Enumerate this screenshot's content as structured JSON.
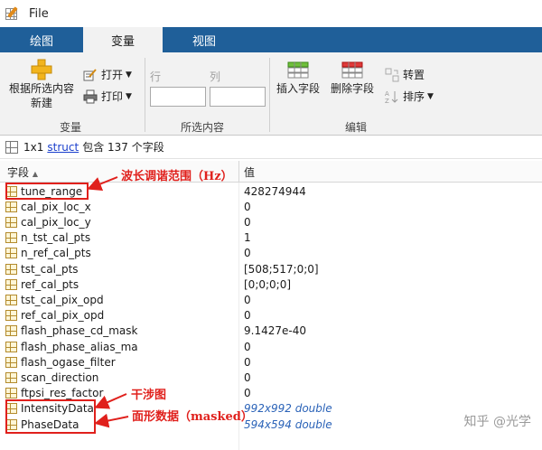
{
  "window": {
    "title": "File"
  },
  "tabs": [
    {
      "label": "绘图"
    },
    {
      "label": "变量"
    },
    {
      "label": "视图"
    }
  ],
  "ribbon": {
    "variable": {
      "new_from_selection_line1": "根据所选内容",
      "new_from_selection_line2": "新建",
      "open": "打开",
      "print": "打印",
      "group_label": "变量"
    },
    "selection": {
      "row_label": "行",
      "col_label": "列",
      "group_label": "所选内容"
    },
    "edit": {
      "insert_field": "插入字段",
      "delete_field": "删除字段",
      "transpose": "转置",
      "sort": "排序",
      "group_label": "编辑"
    }
  },
  "info": {
    "size": "1x1",
    "type_link": "struct",
    "desc": "包含 137 个字段"
  },
  "table": {
    "col_field": "字段",
    "col_value": "值",
    "rows": [
      {
        "name": "tune_range",
        "value": "428274944"
      },
      {
        "name": "cal_pix_loc_x",
        "value": "0"
      },
      {
        "name": "cal_pix_loc_y",
        "value": "0"
      },
      {
        "name": "n_tst_cal_pts",
        "value": "1"
      },
      {
        "name": "n_ref_cal_pts",
        "value": "0"
      },
      {
        "name": "tst_cal_pts",
        "value": "[508;517;0;0]"
      },
      {
        "name": "ref_cal_pts",
        "value": "[0;0;0;0]"
      },
      {
        "name": "tst_cal_pix_opd",
        "value": "0"
      },
      {
        "name": "ref_cal_pix_opd",
        "value": "0"
      },
      {
        "name": "flash_phase_cd_mask",
        "value": "9.1427e-40"
      },
      {
        "name": "flash_phase_alias_ma",
        "value": "0"
      },
      {
        "name": "flash_ogase_filter",
        "value": "0"
      },
      {
        "name": "scan_direction",
        "value": "0"
      },
      {
        "name": "ftpsi_res_factor",
        "value": "0"
      },
      {
        "name": "IntensityData",
        "value": "992x992 double"
      },
      {
        "name": "PhaseData",
        "value": "594x594 double"
      }
    ]
  },
  "annotations": {
    "tune_range": "波长调谐范围（Hz）",
    "intensity": "干涉图",
    "phase": "面形数据（masked）"
  },
  "watermark": "知乎 @光学",
  "colors": {
    "tabbar": "#1f5f99",
    "annotation": "#e0201c",
    "link": "#1a3fcc",
    "matrix_value": "#2b63b8"
  }
}
